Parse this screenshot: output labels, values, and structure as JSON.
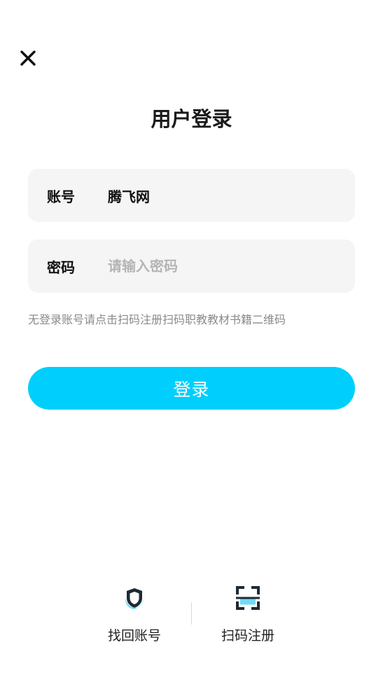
{
  "header": {
    "close_icon": "close-icon",
    "title": "用户登录"
  },
  "form": {
    "account": {
      "label": "账号",
      "value": "腾飞网",
      "placeholder": ""
    },
    "password": {
      "label": "密码",
      "value": "",
      "placeholder": "请输入密码"
    },
    "hint": "无登录账号请点击扫码注册扫码职教教材书籍二维码",
    "submit_label": "登录"
  },
  "footer": {
    "recover": {
      "label": "找回账号",
      "icon": "shield-icon"
    },
    "scan": {
      "label": "扫码注册",
      "icon": "scan-icon"
    }
  },
  "colors": {
    "accent": "#00cffd",
    "field_background": "#f5f5f5",
    "placeholder": "#b5b5b5",
    "hint": "#8a8a8a"
  }
}
